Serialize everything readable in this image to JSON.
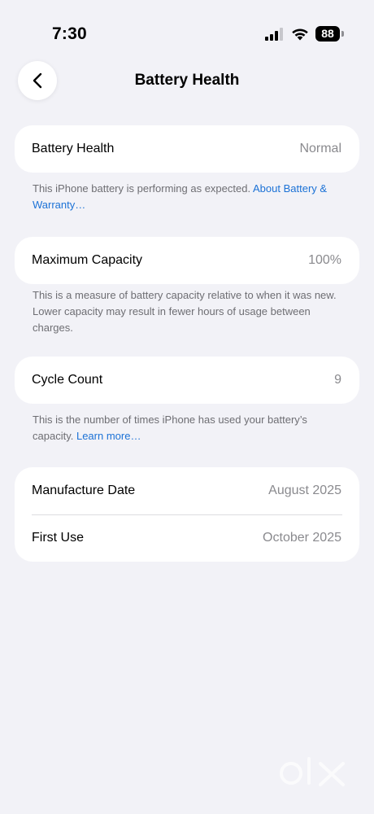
{
  "status_bar": {
    "time": "7:30",
    "battery_level": "88",
    "icons": [
      "signal-icon",
      "wifi-icon",
      "battery-icon"
    ]
  },
  "nav": {
    "title": "Battery Health",
    "back_icon": "chevron-left-icon"
  },
  "battery_health": {
    "label": "Battery Health",
    "value": "Normal",
    "note": "This iPhone battery is performing as expected.",
    "note_link": "About Battery & Warranty…"
  },
  "maximum_capacity": {
    "label": "Maximum Capacity",
    "value": "100%",
    "note": "This is a measure of battery capacity relative to when it was new. Lower capacity may result in fewer hours of usage between charges."
  },
  "cycle_count": {
    "label": "Cycle Count",
    "value": "9",
    "note": "This is the number of times iPhone has used your battery’s capacity.",
    "note_link": "Learn more…"
  },
  "dates": {
    "manufacture_label": "Manufacture Date",
    "manufacture_value": "August 2025",
    "first_use_label": "First Use",
    "first_use_value": "October 2025"
  },
  "colors": {
    "background": "#f2f2f7",
    "card": "#ffffff",
    "link": "#1c72d6",
    "secondary_text": "#8a8a8e"
  }
}
